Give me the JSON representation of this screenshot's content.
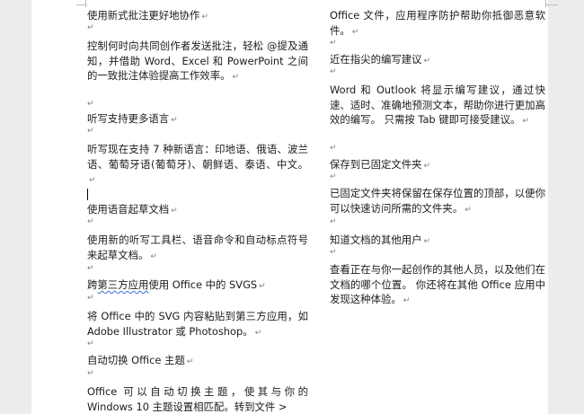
{
  "left_column": {
    "h1": "使用新式批注更好地协作",
    "p1": "控制何时向共同创作者发送批注，轻松 @提及通知，并借助 Word、Excel 和 PowerPoint 之间的一致批注体验提高工作效率。",
    "h2": "听写支持更多语言",
    "p2": "听写现在支持 7 种新语言：印地语、俄语、波兰语、葡萄牙语(葡萄牙)、朝鲜语、泰语、中文。",
    "h3": "使用语音起草文档",
    "p3": "使用新的听写工具栏、语音命令和自动标点符号来起草文档。",
    "h4_pre": "跨",
    "h4_sq": "第三方应用",
    "h4_post": "使用 Office 中的 SVGS",
    "p4": "将 Office 中的 SVG 内容粘贴到第三方应用，如 Adobe Illustrator 或 Photoshop。",
    "h5": "自动切换 Office 主题",
    "p5": "Office 可以自动切换主题，使其与你的 Windows 10 主题设置相匹配。转到文件 >"
  },
  "right_column": {
    "p0": "Office 文件，应用程序防护帮助你抵御恶意软件。",
    "h1": "近在指尖的编写建议",
    "p1": "Word 和 Outlook 将显示编写建议，通过快速、适时、准确地预测文本，帮助你进行更加高效的编写。 只需按 Tab 键即可接受建议。",
    "h2": "保存到已固定文件夹",
    "p2": "已固定文件夹将保留在保存位置的顶部，以便你可以快速访问所需的文件夹。",
    "h3": "知道文档的其他用户",
    "p3": "查看正在与你一起创作的其他人员，以及他们在文档的哪个位置。 你还将在其他 Office 应用中发现这种体验。"
  },
  "marks": {
    "paragraph": "↵"
  }
}
